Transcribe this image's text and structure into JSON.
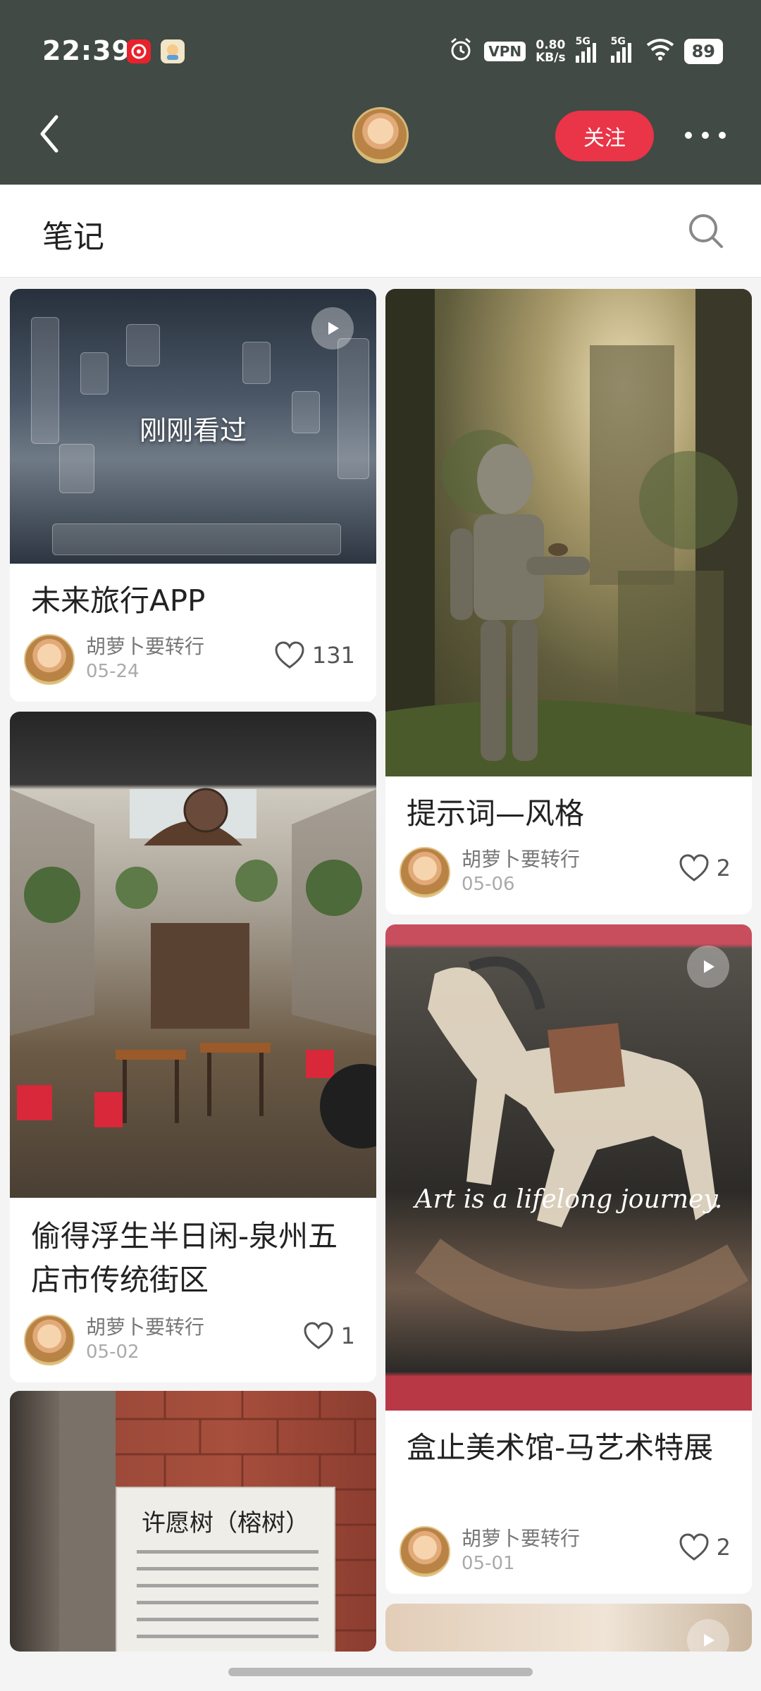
{
  "status_bar": {
    "time": "22:39",
    "vpn": "VPN",
    "speed_value": "0.80",
    "speed_unit": "KB/s",
    "network_1": "5G",
    "network_2": "5G",
    "battery": "89"
  },
  "header": {
    "follow_label": "关注"
  },
  "section": {
    "title": "笔记"
  },
  "notes": [
    {
      "title": "未来旅行APP",
      "author": "胡萝卜要转行",
      "date": "05-24",
      "likes": "131",
      "overlay": "刚刚看过",
      "has_video": true
    },
    {
      "title": "提示词—风格",
      "author": "胡萝卜要转行",
      "date": "05-06",
      "likes": "2",
      "has_video": false
    },
    {
      "title": "偷得浮生半日闲-泉州五店市传统街区",
      "author": "胡萝卜要转行",
      "date": "05-02",
      "likes": "1",
      "has_video": false
    },
    {
      "title": "盒止美术馆-马艺术特展",
      "author": "胡萝卜要转行",
      "date": "05-01",
      "likes": "2",
      "overlay": "Art is a lifelong journey.",
      "has_video": true
    },
    {
      "sign_title": "许愿树（榕树）"
    },
    {
      "has_video": true
    }
  ],
  "colors": {
    "header_bg": "#414a45",
    "follow_button": "#ea3447",
    "page_bg": "#f4f4f4"
  }
}
